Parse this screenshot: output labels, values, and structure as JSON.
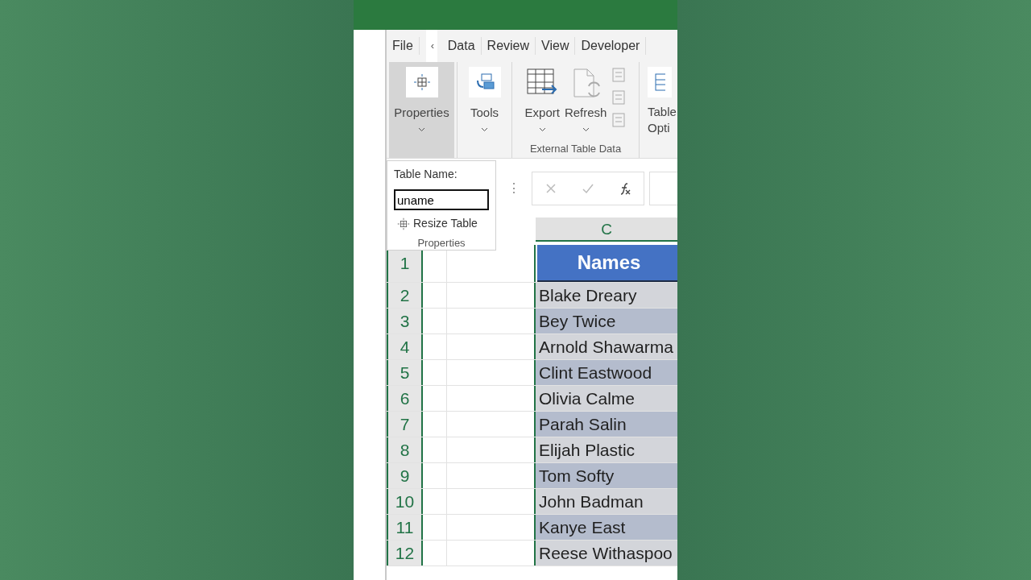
{
  "ribbon": {
    "tabs": [
      {
        "label": "File",
        "kind": "tab"
      },
      {
        "label": "‹",
        "kind": "scroll"
      },
      {
        "label": "Data",
        "kind": "tab"
      },
      {
        "label": "Review",
        "kind": "tab"
      },
      {
        "label": "View",
        "kind": "tab"
      },
      {
        "label": "Developer",
        "kind": "tab"
      }
    ],
    "groups": [
      {
        "kind": "single",
        "label": "Properties",
        "pressed": true
      },
      {
        "kind": "single",
        "label": "Tools",
        "pressed": false
      },
      {
        "kind": "multi",
        "title": "External Table Data",
        "buttons": [
          {
            "label": "Export"
          },
          {
            "label": "Refresh"
          }
        ]
      },
      {
        "kind": "cut",
        "label": "Table",
        "label_2": "Opti"
      }
    ]
  },
  "popup": {
    "label": "Table Name:",
    "value": "uname",
    "command": "Resize Table",
    "group": "Properties"
  },
  "formula_bar": {
    "grip": "⋮"
  },
  "sheet": {
    "column": "C",
    "header": "Names",
    "rows": [
      {
        "number": "1"
      },
      {
        "number": "2",
        "name": "Blake Dreary"
      },
      {
        "number": "3",
        "name": "Bey Twice"
      },
      {
        "number": "4",
        "name": "Arnold Shawarma"
      },
      {
        "number": "5",
        "name": "Clint Eastwood"
      },
      {
        "number": "6",
        "name": "Olivia Calme"
      },
      {
        "number": "7",
        "name": "Parah Salin"
      },
      {
        "number": "8",
        "name": "Elijah Plastic"
      },
      {
        "number": "9",
        "name": "Tom Softy"
      },
      {
        "number": "10",
        "name": "John Badman"
      },
      {
        "number": "11",
        "name": "Kanye East"
      },
      {
        "number": "12",
        "name": "Reese Withaspoo"
      }
    ]
  }
}
